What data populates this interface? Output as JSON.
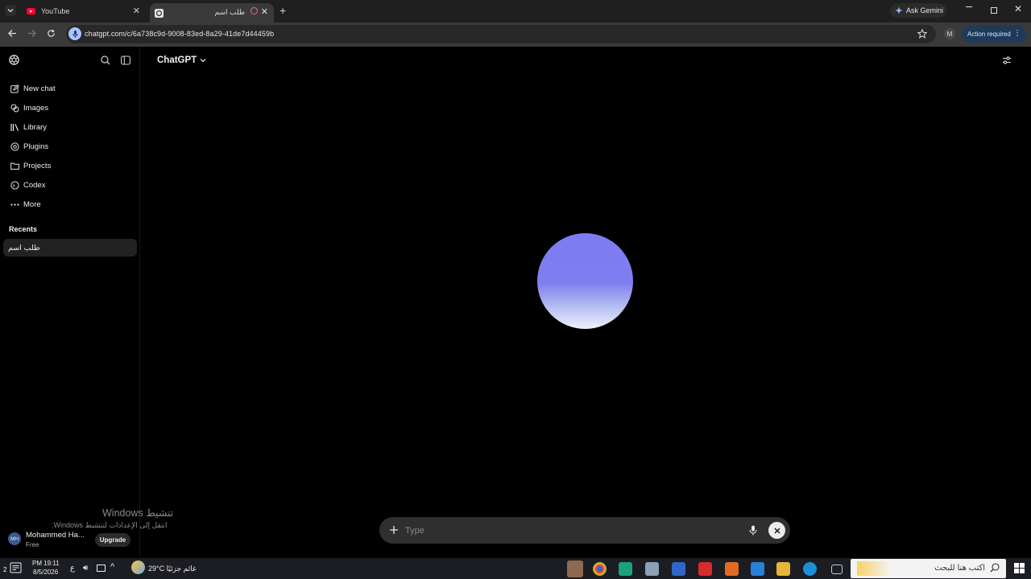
{
  "browser": {
    "tabs": [
      {
        "title": "YouTube",
        "active": false
      },
      {
        "title": "طلب اسم",
        "active": true
      }
    ],
    "ask_gemini": "Ask Gemini",
    "url": "chatgpt.com/c/6a738c9d-9008-83ed-8a29-41de7d44459b",
    "profile_initial": "M",
    "action_required": "Action required"
  },
  "sidebar": {
    "nav": [
      {
        "label": "New chat",
        "icon": "new-chat-icon"
      },
      {
        "label": "Images",
        "icon": "images-icon"
      },
      {
        "label": "Library",
        "icon": "library-icon"
      },
      {
        "label": "Plugins",
        "icon": "plugins-icon"
      },
      {
        "label": "Projects",
        "icon": "folder-icon"
      },
      {
        "label": "Codex",
        "icon": "codex-icon"
      },
      {
        "label": "More",
        "icon": "more-icon"
      }
    ],
    "recents_heading": "Recents",
    "recents": [
      "طلب اسم"
    ],
    "user": {
      "initials": "MH",
      "name": "Mohammed Ha...",
      "plan": "Free",
      "upgrade": "Upgrade"
    }
  },
  "main": {
    "title": "ChatGPT",
    "composer_placeholder": "Type"
  },
  "watermark": {
    "line1": "تنشيط Windows",
    "line2": "انتقل إلى الإعدادات لتنشيط Windows."
  },
  "taskbar": {
    "time": "PM 19:11",
    "date": "8/5/2026",
    "lang": "ع",
    "weather": "29°C  غائم جزئيًا",
    "search_placeholder": "اكتب هنا للبحث",
    "notification_count": "2"
  },
  "colors": {
    "accent_orb_top": "#7e7bf2",
    "action_required_bg": "#1e3a58",
    "youtube_red": "#ff0033"
  }
}
